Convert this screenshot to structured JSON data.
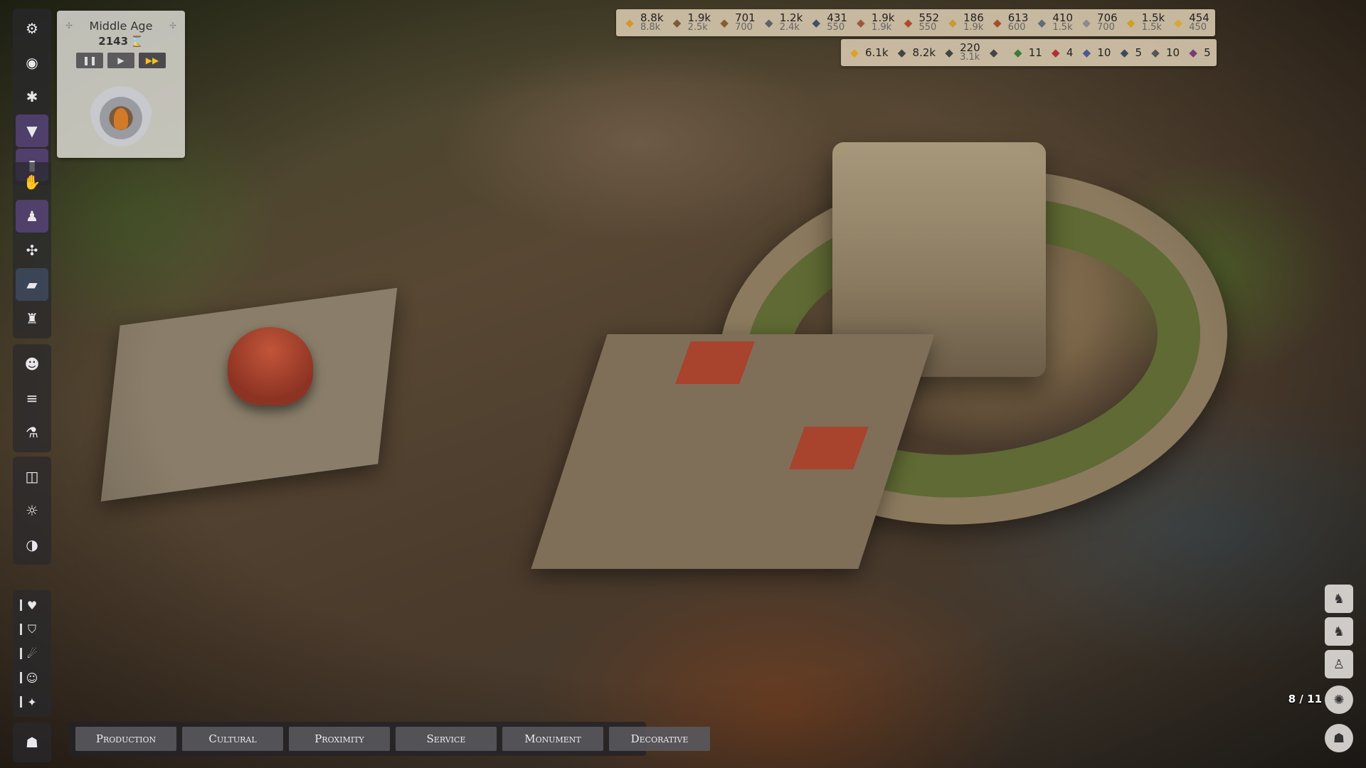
{
  "era": {
    "name": "Middle Age",
    "year": "2143",
    "hourglass": "⌛",
    "controls": {
      "pause": "❚❚",
      "play": "▶",
      "fast_forward": "▶▶"
    }
  },
  "resources_top": [
    {
      "name": "food",
      "icon": "food-icon",
      "value": "8.8k",
      "capacity": "8.8k",
      "color": "#d8952f"
    },
    {
      "name": "wood-animals",
      "icon": "boar-icon",
      "value": "1.9k",
      "capacity": "2.5k",
      "color": "#7a5a3a"
    },
    {
      "name": "logs",
      "icon": "log-icon",
      "value": "701",
      "capacity": "700",
      "color": "#8a5a30"
    },
    {
      "name": "tools",
      "icon": "tools-icon",
      "value": "1.2k",
      "capacity": "2.4k",
      "color": "#606068"
    },
    {
      "name": "stone",
      "icon": "stone-icon",
      "value": "431",
      "capacity": "550",
      "color": "#3f4f6a"
    },
    {
      "name": "fabric",
      "icon": "yarn-icon",
      "value": "1.9k",
      "capacity": "1.9k",
      "color": "#9a5a3a"
    },
    {
      "name": "bricks",
      "icon": "brick-icon",
      "value": "552",
      "capacity": "550",
      "color": "#b04a2a"
    },
    {
      "name": "grain",
      "icon": "hay-icon",
      "value": "186",
      "capacity": "1.9k",
      "color": "#c89a30"
    },
    {
      "name": "leather",
      "icon": "leather-icon",
      "value": "613",
      "capacity": "600",
      "color": "#a05028"
    },
    {
      "name": "iron",
      "icon": "iron-icon",
      "value": "410",
      "capacity": "1.5k",
      "color": "#606c7a"
    },
    {
      "name": "paper",
      "icon": "paper-icon",
      "value": "706",
      "capacity": "700",
      "color": "#8a8a90"
    },
    {
      "name": "gold",
      "icon": "coin-icon",
      "value": "1.5k",
      "capacity": "1.5k",
      "color": "#d0a020"
    },
    {
      "name": "luxury",
      "icon": "gold-bar-icon",
      "value": "454",
      "capacity": "450",
      "color": "#d8a830"
    }
  ],
  "resources_bottom": [
    {
      "name": "coins",
      "icon": "coins-icon",
      "value": "6.1k",
      "capacity": "",
      "color": "#e0a020"
    },
    {
      "name": "population",
      "icon": "population-icon",
      "value": "8.2k",
      "capacity": "",
      "color": "#444"
    },
    {
      "name": "workers",
      "icon": "workers-icon",
      "value": "220",
      "capacity": "3.1k",
      "color": "#444"
    },
    {
      "name": "happiness",
      "icon": "people-group-icon",
      "value": "",
      "capacity": "",
      "color": "#444"
    },
    {
      "name": "green-tokens",
      "icon": "green-token-icon",
      "value": "11",
      "capacity": "",
      "color": "#3a7a3a"
    },
    {
      "name": "red-tokens",
      "icon": "red-token-icon",
      "value": "4",
      "capacity": "",
      "color": "#b03030"
    },
    {
      "name": "scholars",
      "icon": "scholar-icon",
      "value": "10",
      "capacity": "",
      "color": "#4a5a8a"
    },
    {
      "name": "education",
      "icon": "graduation-cap-icon",
      "value": "5",
      "capacity": "",
      "color": "#3a4a5a"
    },
    {
      "name": "priests",
      "icon": "priest-icon",
      "value": "10",
      "capacity": "",
      "color": "#555"
    },
    {
      "name": "nobles",
      "icon": "noble-icon",
      "value": "5",
      "capacity": "",
      "color": "#7a3a7a"
    }
  ],
  "categories": [
    "Production",
    "Cultural",
    "Proximity",
    "Service",
    "Monument",
    "Decorative"
  ],
  "pagination": "8 / 11",
  "left_toolbar": {
    "group1": [
      {
        "name": "settings-icon",
        "glyph": "⚙"
      },
      {
        "name": "hide-icon",
        "glyph": "◉"
      },
      {
        "name": "bug-icon",
        "glyph": "✱"
      },
      {
        "name": "filter-icon",
        "glyph": "▼"
      },
      {
        "name": "book-icon",
        "glyph": "▮"
      }
    ],
    "group2": [
      {
        "name": "build-workers-icon",
        "glyph": "✋"
      },
      {
        "name": "citizen-icon",
        "glyph": "♟"
      },
      {
        "name": "resources-icon",
        "glyph": "✣"
      },
      {
        "name": "education-icon",
        "glyph": "▰"
      },
      {
        "name": "trophy-icon",
        "glyph": "♜"
      }
    ],
    "group3": [
      {
        "name": "group-icon",
        "glyph": "☻"
      },
      {
        "name": "list-icon",
        "glyph": "≡"
      },
      {
        "name": "potion-icon",
        "glyph": "⚗"
      }
    ],
    "group4": [
      {
        "name": "camera-icon",
        "glyph": "◫"
      },
      {
        "name": "sun-icon",
        "glyph": "☼"
      },
      {
        "name": "globe-icon",
        "glyph": "◑"
      }
    ],
    "group5": [
      {
        "name": "health-icon",
        "glyph": "♥"
      },
      {
        "name": "shield-icon",
        "glyph": "⛉"
      },
      {
        "name": "fire-icon",
        "glyph": "☄"
      },
      {
        "name": "person-icon",
        "glyph": "☺"
      },
      {
        "name": "faith-icon",
        "glyph": "✦"
      }
    ],
    "group6": [
      {
        "name": "council-icon",
        "glyph": "☗"
      }
    ]
  },
  "right_toolbar": [
    {
      "name": "unit-icon-1",
      "glyph": "♞"
    },
    {
      "name": "unit-icon-2",
      "glyph": "♞"
    },
    {
      "name": "unit-icon-3",
      "glyph": "♙"
    },
    {
      "name": "settings-icon",
      "glyph": "✺"
    },
    {
      "name": "council-icon",
      "glyph": "☗"
    }
  ]
}
